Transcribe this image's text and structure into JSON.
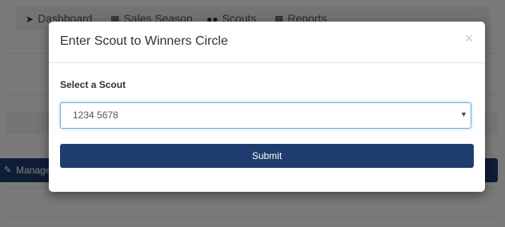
{
  "nav": {
    "items": [
      {
        "label": "Dashboard",
        "icon": "rocket-icon"
      },
      {
        "label": "Sales Season",
        "icon": "file-icon"
      },
      {
        "label": "Scouts",
        "icon": "users-icon"
      },
      {
        "label": "Reports",
        "icon": "bar-chart-icon"
      }
    ]
  },
  "background": {
    "manage_label": "Manage"
  },
  "modal": {
    "title": "Enter Scout to Winners Circle",
    "close_symbol": "×",
    "field_label": "Select a Scout",
    "selected_value": "1234 5678",
    "submit_label": "Submit"
  },
  "colors": {
    "primary": "#1f3c6e",
    "focus_border": "#66afe9"
  }
}
